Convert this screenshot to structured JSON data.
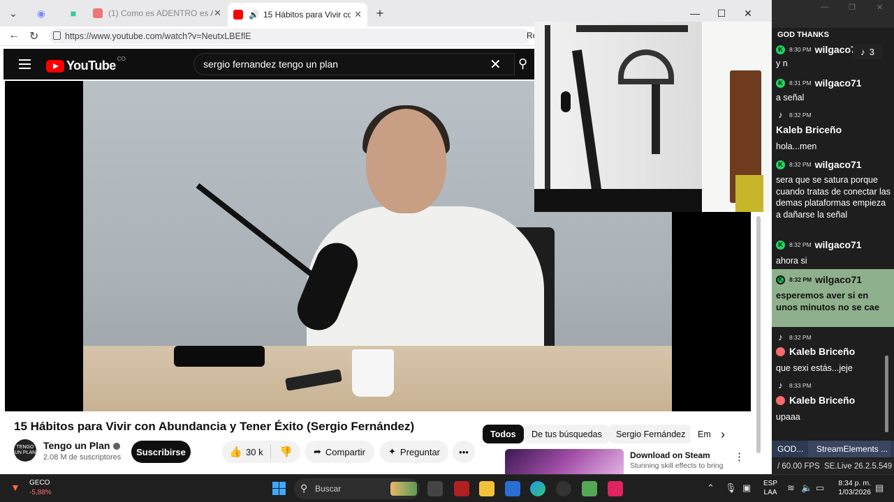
{
  "browser": {
    "tabs": [
      {
        "label": "(1) Como es ADENTRO es AFUERA",
        "active": false
      },
      {
        "label": "15 Hábitos para Vivir con Abu",
        "active": true
      }
    ],
    "url": "https://www.youtube.com/watch?v=NeutxLBEflE",
    "read_mode_label": "Re"
  },
  "youtube": {
    "logo_text": "YouTube",
    "country_code": "CO",
    "search_query": "sergio fernandez tengo un plan",
    "video_title": "15 Hábitos para Vivir con Abundancia y Tener Éxito (Sergio Fernández)",
    "channel_name": "Tengo un Plan",
    "avatar_text": "TENGO UN PLAN",
    "subscribers": "2.08 M de suscriptores",
    "subscribe_label": "Suscribirse",
    "likes": "30 k",
    "share_label": "Compartir",
    "ask_label": "Preguntar",
    "chips": [
      "Todos",
      "De tus búsquedas",
      "Sergio Fernández",
      "Em"
    ],
    "recommendation": {
      "title": "Download on Steam",
      "description": "Stunning skill effects to bring"
    }
  },
  "chat": {
    "header": "GOD THANKS",
    "tiktok_viewers": "3",
    "messages": [
      {
        "time": "8:30 PM",
        "user": "wilgaco71",
        "text": "y n",
        "platform": "kick"
      },
      {
        "time": "8:31 PM",
        "user": "wilgaco71",
        "text": "a señal",
        "platform": "kick"
      },
      {
        "time": "8:32 PM",
        "user": "Kaleb Briceño",
        "text": "hola...men",
        "platform": "tiktok"
      },
      {
        "time": "8:32 PM",
        "user": "wilgaco71",
        "text": "sera que se satura porque cuando tratas de conectar las demas plataformas empieza a dañarse la señal",
        "platform": "kick"
      },
      {
        "time": "8:32 PM",
        "user": "wilgaco71",
        "text": "ahora si",
        "platform": "kick"
      },
      {
        "time": "8:32 PM",
        "user": "wilgaco71",
        "text": "esperemos aver si en unos minutos no se cae",
        "platform": "kick"
      },
      {
        "time": "8:32 PM",
        "user": "Kaleb Briceño",
        "text": "que sexi estás...jeje",
        "platform": "tiktok"
      },
      {
        "time": "8:33 PM",
        "user": "Kaleb Briceño",
        "text": "upaaa",
        "platform": "tiktok"
      }
    ],
    "tabs": [
      "GOD...",
      "StreamElements ..."
    ],
    "fps": "/ 60.00 FPS",
    "version": "SE.Live 26.2.5.549"
  },
  "taskbar": {
    "weather_name": "GECO",
    "weather_value": "-5,88%",
    "search_placeholder": "Buscar",
    "lang_top": "ESP",
    "lang_bottom": "LAA",
    "time": "8:34 p. m.",
    "date": "1/03/2026"
  },
  "colors": {
    "youtube_red": "#ff0000",
    "kick_green": "#1fd65f",
    "highlight": "#8fb08c"
  }
}
